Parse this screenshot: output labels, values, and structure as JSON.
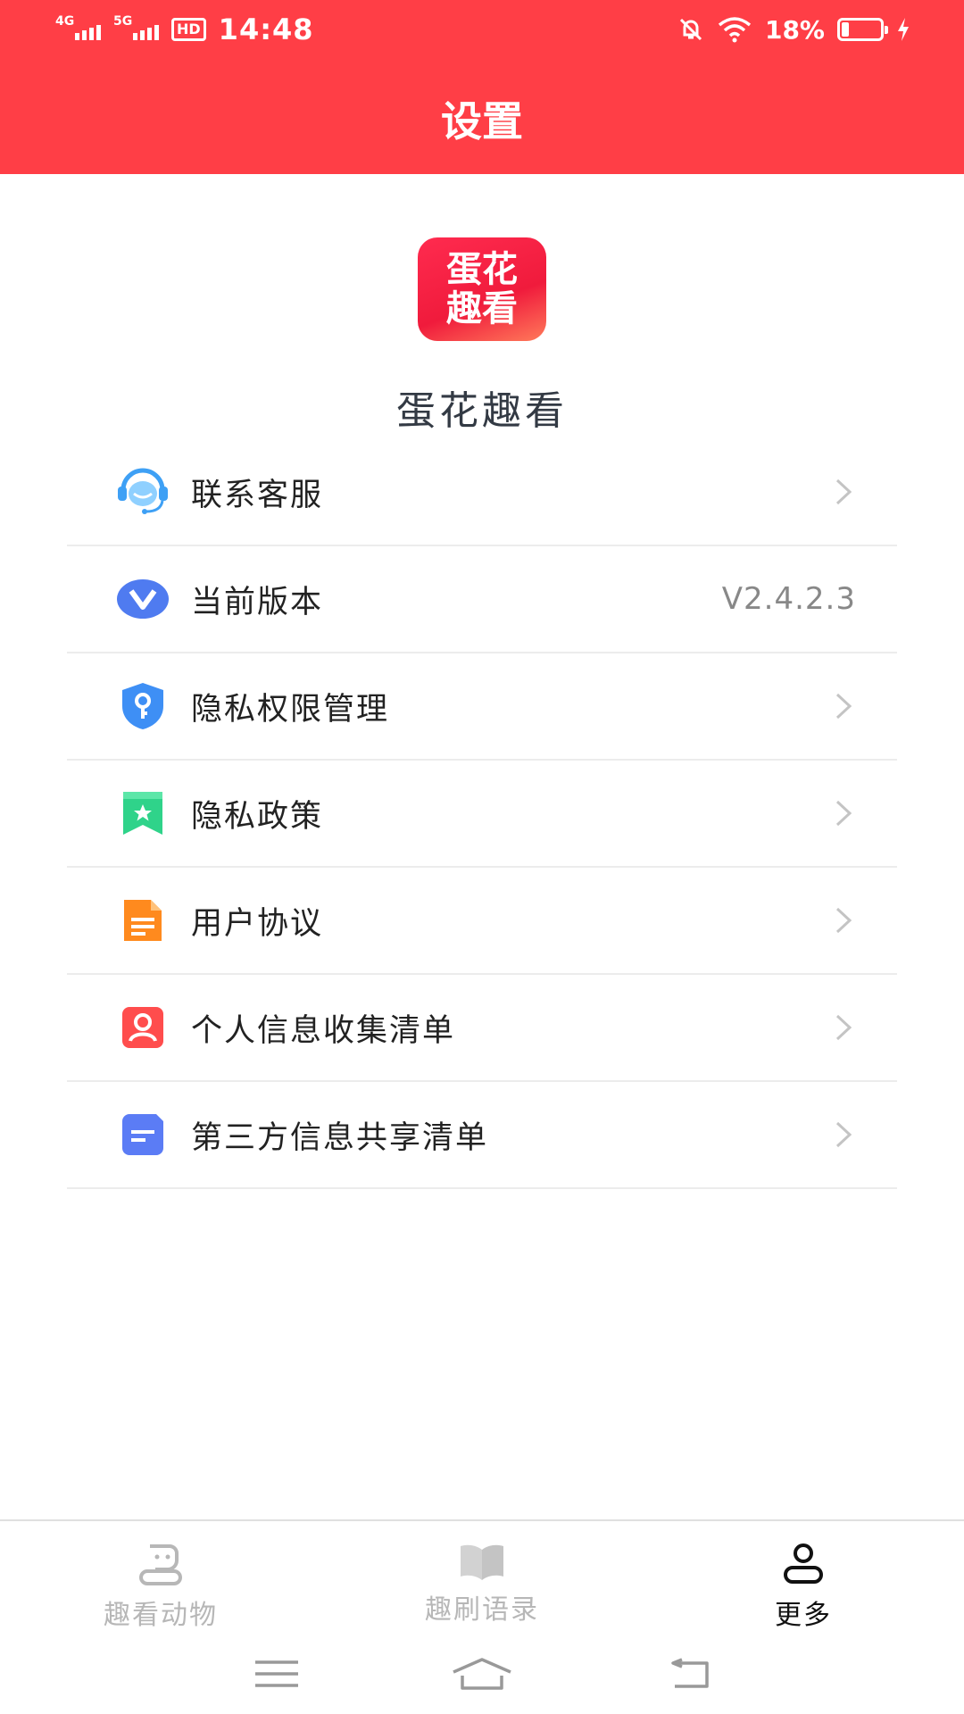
{
  "status_bar": {
    "signal_1": "4G",
    "signal_2": "5G",
    "hd": "HD",
    "time": "14:48",
    "battery_percent": "18%",
    "battery_level": 0.18
  },
  "header": {
    "title": "设置"
  },
  "app": {
    "logo_line1": "蛋花",
    "logo_line2": "趣看",
    "name": "蛋花趣看"
  },
  "menu": {
    "items": [
      {
        "label": "联系客服",
        "icon": "customer-service-icon",
        "color": "#3ea0f5"
      },
      {
        "label": "当前版本",
        "icon": "version-icon",
        "color": "#4f7bf0",
        "value": "V2.4.2.3"
      },
      {
        "label": "隐私权限管理",
        "icon": "shield-key-icon",
        "color": "#3e8ff5"
      },
      {
        "label": "隐私政策",
        "icon": "bookmark-star-icon",
        "color": "#2fd38a"
      },
      {
        "label": "用户协议",
        "icon": "document-icon",
        "color": "#ff8a1e"
      },
      {
        "label": "个人信息收集清单",
        "icon": "user-card-icon",
        "color": "#ff4d4d"
      },
      {
        "label": "第三方信息共享清单",
        "icon": "list-icon",
        "color": "#5b7cf5"
      }
    ]
  },
  "tabbar": {
    "tabs": [
      {
        "label": "趣看动物",
        "icon": "animal-icon",
        "active": false
      },
      {
        "label": "趣刷语录",
        "icon": "book-icon",
        "active": false
      },
      {
        "label": "更多",
        "icon": "person-icon",
        "active": true
      }
    ]
  },
  "colors": {
    "brand": "#ff3e46",
    "divider": "#ececec"
  }
}
